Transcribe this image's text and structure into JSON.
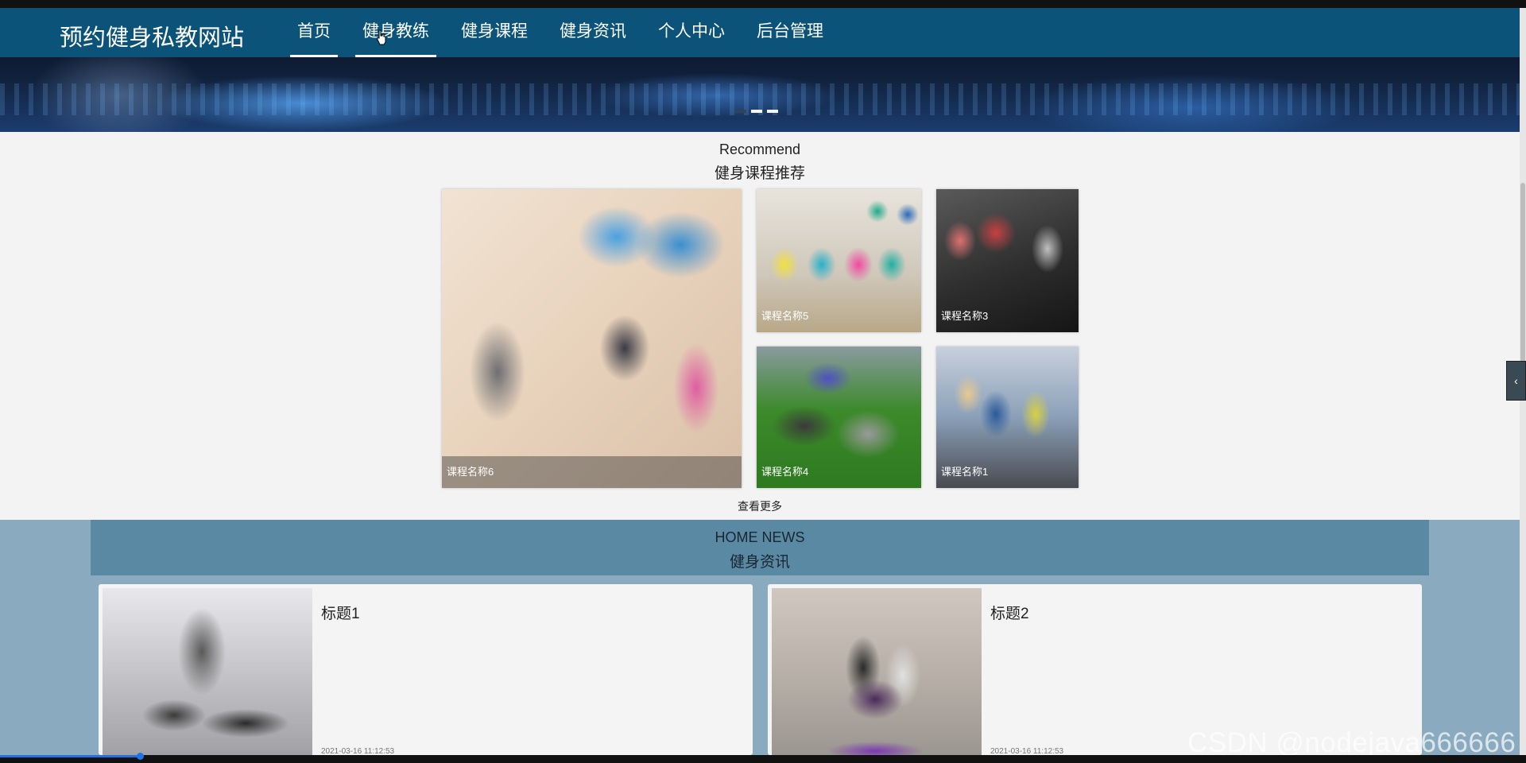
{
  "site": {
    "logo": "预约健身私教网站"
  },
  "nav": {
    "items": [
      {
        "label": "首页"
      },
      {
        "label": "健身教练"
      },
      {
        "label": "健身课程"
      },
      {
        "label": "健身资讯"
      },
      {
        "label": "个人中心"
      },
      {
        "label": "后台管理"
      }
    ]
  },
  "recommend": {
    "title_en": "Recommend",
    "title_zh": "健身课程推荐",
    "courses": [
      {
        "name": "课程名称6"
      },
      {
        "name": "课程名称5"
      },
      {
        "name": "课程名称3"
      },
      {
        "name": "课程名称4"
      },
      {
        "name": "课程名称1"
      }
    ],
    "more_label": "查看更多"
  },
  "news": {
    "title_en": "HOME NEWS",
    "title_zh": "健身资讯",
    "items": [
      {
        "title": "标题1",
        "date": "2021-03-16 11:12:53"
      },
      {
        "title": "标题2",
        "date": "2021-03-16 11:12:53"
      }
    ]
  },
  "watermark": "CSDN @nodejava666666",
  "colors": {
    "nav_bg": "#0b5378",
    "news_band": "#8aabbf",
    "news_head": "#5a89a4"
  }
}
